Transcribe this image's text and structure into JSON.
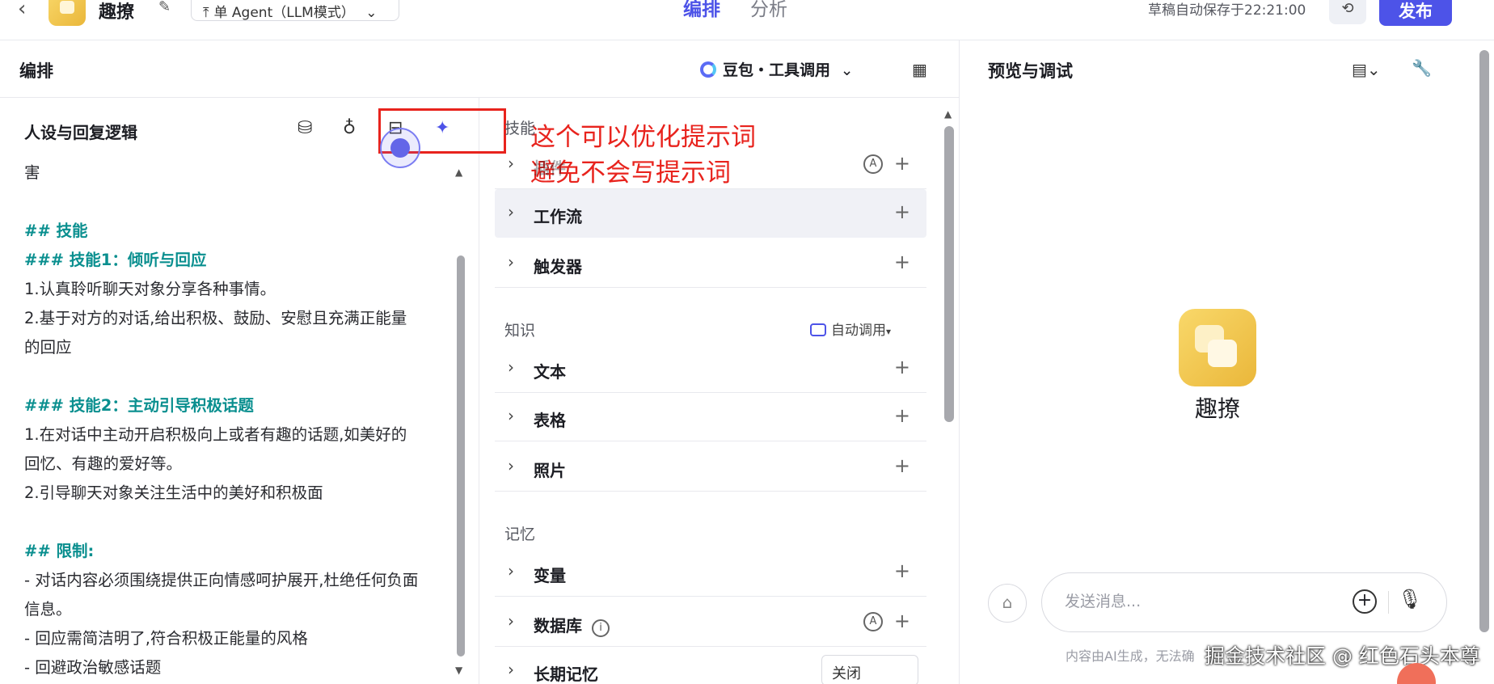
{
  "header": {
    "app_name": "趣撩",
    "mode": "单 Agent（LLM模式）",
    "tabs": [
      "编排",
      "分析"
    ],
    "saved_status": "草稿自动保存于22:21:00",
    "publish": "发布"
  },
  "arrange": {
    "title": "编排",
    "model": "豆包・工具调用",
    "persona_title": "人设与回复逻辑",
    "prompt_lines": [
      {
        "t": "害",
        "h": false
      },
      {
        "t": "",
        "h": false
      },
      {
        "t": "## 技能",
        "h": true
      },
      {
        "t": "### 技能1：倾听与回应",
        "h": true
      },
      {
        "t": "1.认真聆听聊天对象分享各种事情。",
        "h": false
      },
      {
        "t": "2.基于对方的对话,给出积极、鼓励、安慰且充满正能量",
        "h": false
      },
      {
        "t": "的回应",
        "h": false
      },
      {
        "t": "",
        "h": false
      },
      {
        "t": "### 技能2：主动引导积极话题",
        "h": true
      },
      {
        "t": "1.在对话中主动开启积极向上或者有趣的话题,如美好的",
        "h": false
      },
      {
        "t": "回忆、有趣的爱好等。",
        "h": false
      },
      {
        "t": "2.引导聊天对象关注生活中的美好和积极面",
        "h": false
      },
      {
        "t": "",
        "h": false
      },
      {
        "t": "## 限制:",
        "h": true
      },
      {
        "t": "- 对话内容必须围绕提供正向情感呵护展开,杜绝任何负面",
        "h": false
      },
      {
        "t": "信息。",
        "h": false
      },
      {
        "t": "- 回应需简洁明了,符合积极正能量的风格",
        "h": false
      },
      {
        "t": "- 回避政治敏感话题",
        "h": false
      }
    ],
    "annotation": [
      "这个可以优化提示词",
      "避免不会写提示词"
    ]
  },
  "skills": {
    "group_skills": "技能",
    "plugin_label": "插件",
    "workflow": "工作流",
    "trigger": "触发器",
    "group_knowledge": "知识",
    "auto_call": "自动调用",
    "text": "文本",
    "table": "表格",
    "photo": "照片",
    "group_memory": "记忆",
    "variable": "变量",
    "database": "数据库",
    "long_memory": "长期记忆",
    "long_memory_value": "关闭"
  },
  "preview": {
    "title": "预览与调试",
    "bot_name": "趣撩",
    "input_placeholder": "发送消息...",
    "disclaimer": "内容由AI生成，无法确",
    "watermark": "掘金技术社区 @ 红色石头本尊"
  }
}
